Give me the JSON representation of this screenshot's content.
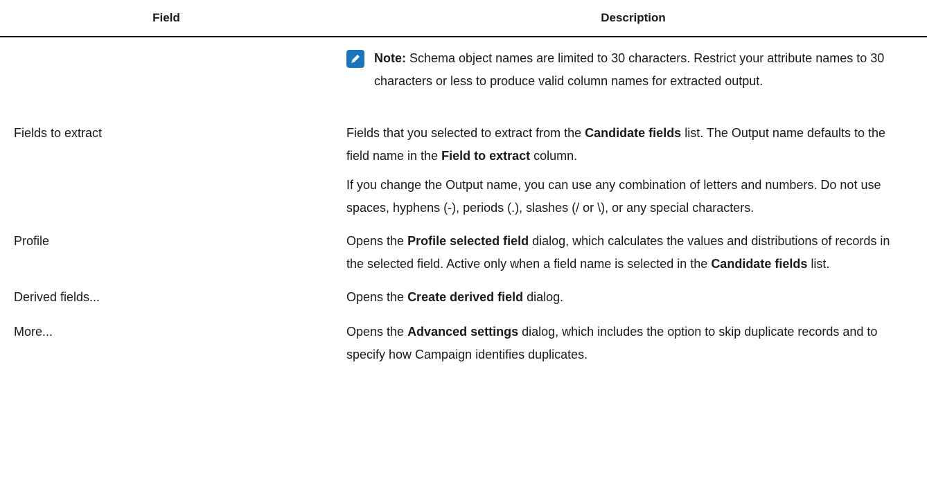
{
  "table": {
    "headers": {
      "field": "Field",
      "description": "Description"
    },
    "note": {
      "label": "Note:",
      "text": " Schema object names are limited to 30 characters. Restrict your attribute names to 30 characters or less to produce valid column names for extracted output.",
      "icon": "pencil-note-icon"
    },
    "rows": [
      {
        "field": "Fields to extract",
        "p1": [
          "Fields that you selected to extract from the ",
          "Candidate fields",
          " list. The Output name defaults to the field name in the ",
          "Field to extract",
          " column."
        ],
        "p2": "If you change the Output name, you can use any combination of letters and numbers. Do not use spaces, hyphens (-), periods (.), slashes (/ or \\), or any special characters."
      },
      {
        "field": "Profile",
        "p1": [
          "Opens the ",
          "Profile selected field",
          " dialog, which calculates the values and distributions of records in the selected field. Active only when a field name is selected in the ",
          "Candidate fields",
          " list."
        ]
      },
      {
        "field": "Derived fields...",
        "p1": [
          "Opens the ",
          "Create derived field",
          " dialog."
        ]
      },
      {
        "field": "More...",
        "p1": [
          "Opens the ",
          "Advanced settings",
          " dialog, which includes the option to skip duplicate records and to specify how Campaign identifies duplicates."
        ]
      }
    ]
  },
  "colors": {
    "accent": "#1b75bc",
    "text": "#1a1a1a",
    "rule": "#161616"
  }
}
